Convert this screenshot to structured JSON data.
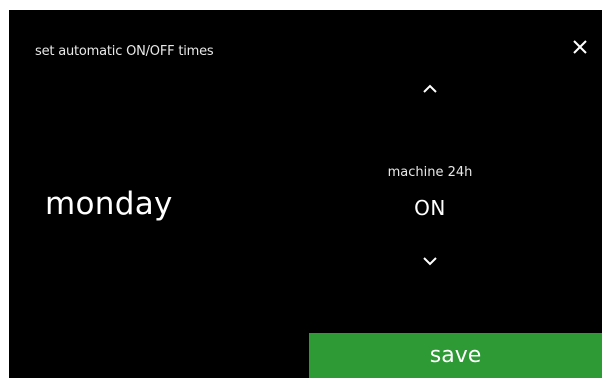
{
  "header": {
    "title": "set automatic ON/OFF times",
    "close_icon": "close-icon"
  },
  "day": {
    "name": "monday"
  },
  "setting": {
    "label": "machine 24h",
    "value": "ON",
    "up_icon": "chevron-up-icon",
    "down_icon": "chevron-down-icon"
  },
  "footer": {
    "save_label": "save",
    "save_color": "#2e9a35"
  },
  "colors": {
    "background": "#000000",
    "text": "#ffffff",
    "accent": "#2e9a35"
  }
}
